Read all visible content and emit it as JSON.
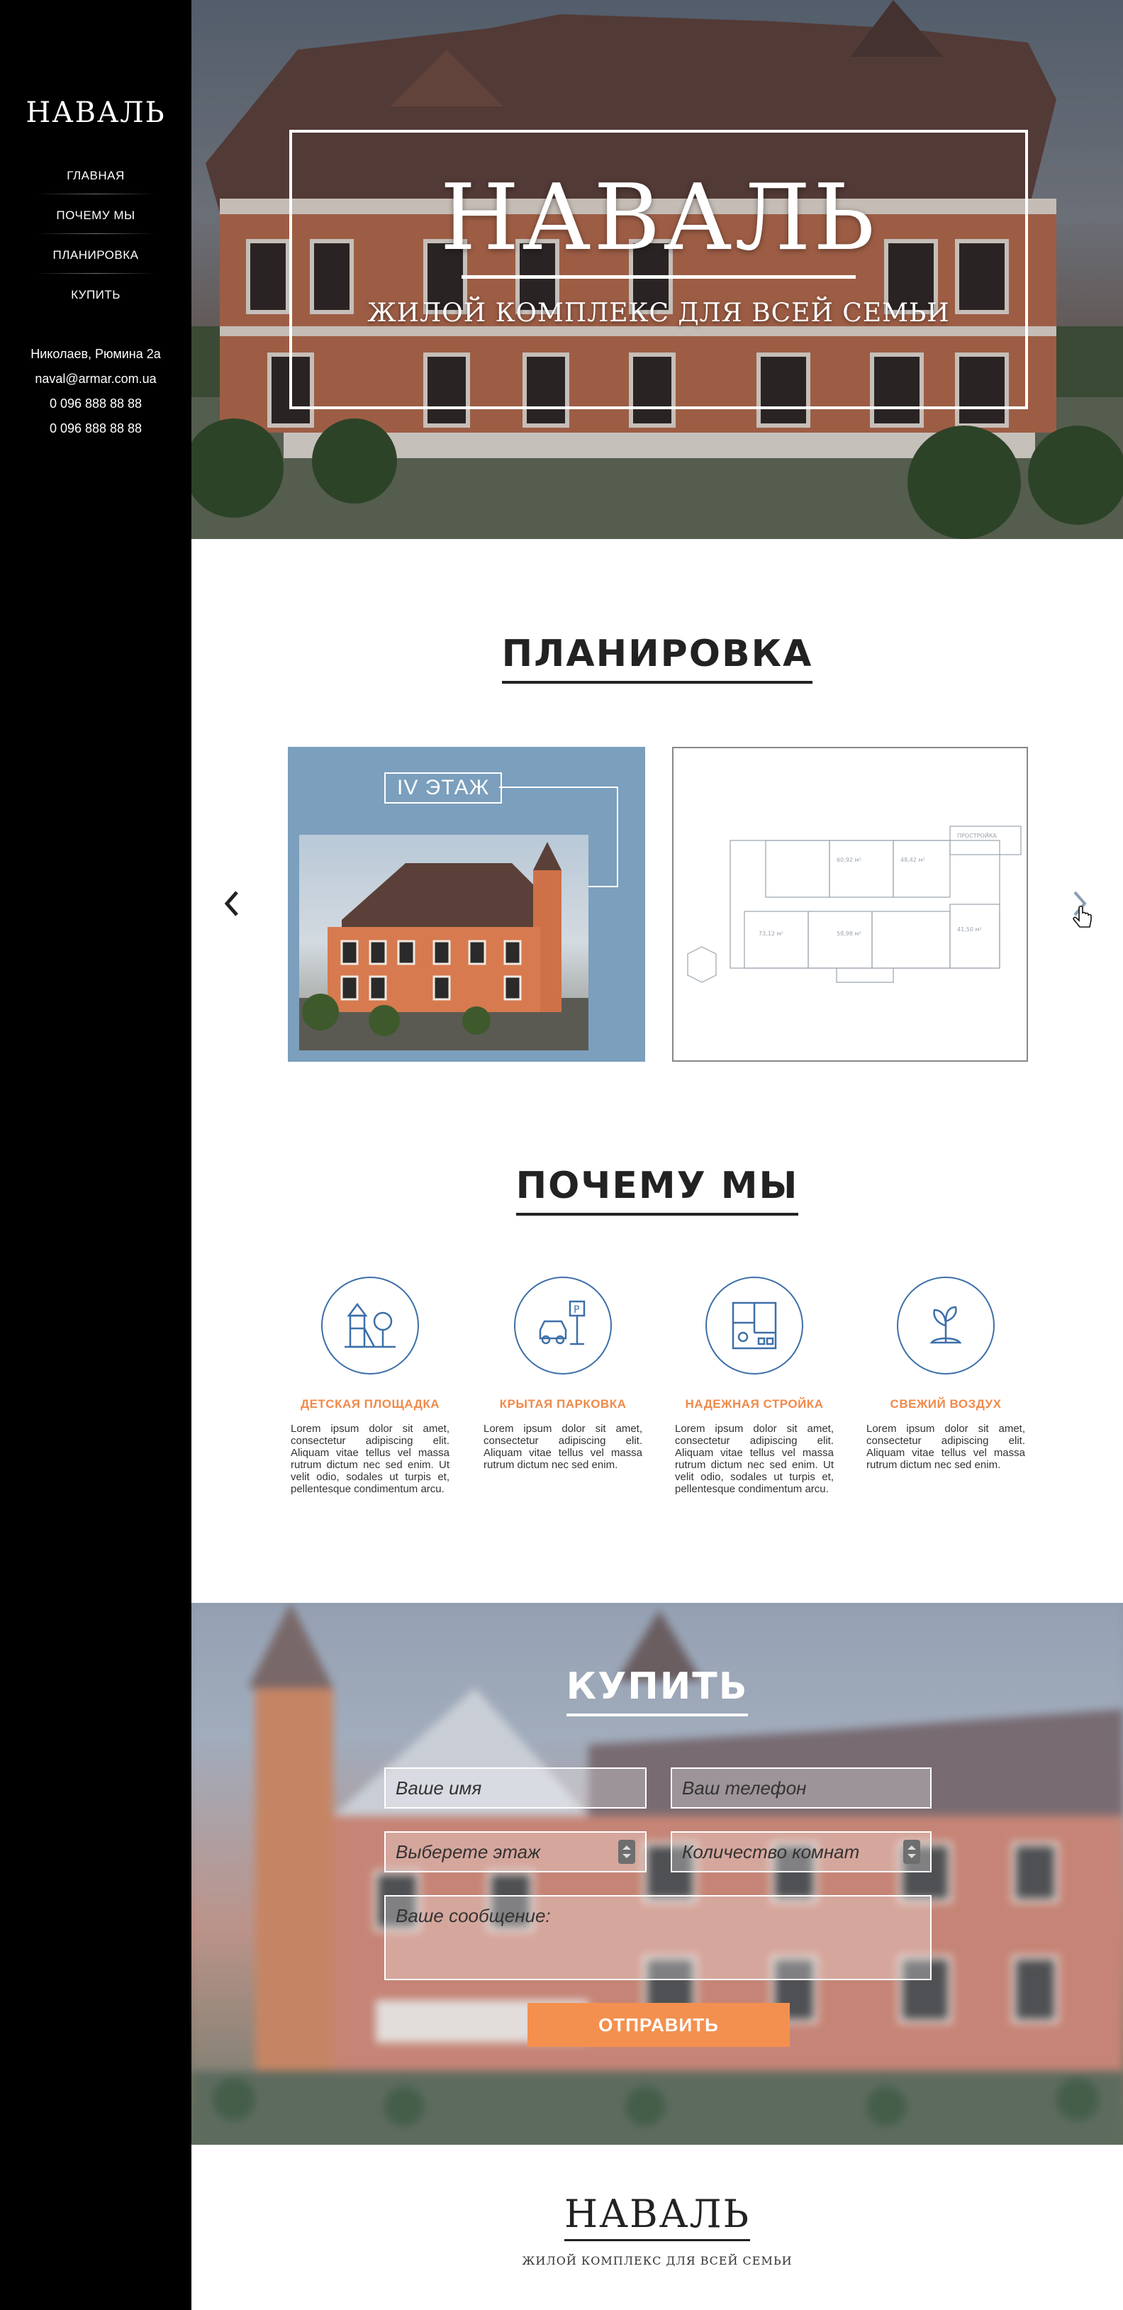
{
  "sidebar": {
    "logo": "НАВАЛЬ",
    "nav": [
      "ГЛАВНАЯ",
      "ПОЧЕМУ МЫ",
      "ПЛАНИРОВКА",
      "КУПИТЬ"
    ],
    "address": "Николаев, Рюмина 2а",
    "email": "naval@armar.com.ua",
    "phone1": "0 096 888 88 88",
    "phone2": "0 096 888 88 88"
  },
  "hero": {
    "title": "НАВАЛЬ",
    "subtitle": "ЖИЛОЙ КОМПЛЕКС ДЛЯ ВСЕЙ СЕМЬИ"
  },
  "plans": {
    "title": "ПЛАНИРОВКА",
    "floor_label": "IV ЭТАЖ",
    "prev_icon": "chevron-left-icon",
    "next_icon": "chevron-right-icon"
  },
  "why": {
    "title": "ПОЧЕМУ МЫ",
    "features": [
      {
        "icon": "playground-icon",
        "title": "ДЕТСКАЯ ПЛОЩАДКА",
        "text": "Lorem ipsum dolor sit amet, consectetur adipiscing elit. Aliquam vitae tellus vel massa rutrum dictum nec sed enim. Ut velit odio, sodales ut turpis et, pellentesque condimentum arcu."
      },
      {
        "icon": "parking-icon",
        "title": "КРЫТАЯ ПАРКОВКА",
        "text": "Lorem ipsum dolor sit amet, consectetur adipiscing elit. Aliquam vitae tellus vel massa rutrum dictum nec sed enim."
      },
      {
        "icon": "floorplan-icon",
        "title": "НАДЕЖНАЯ СТРОЙКА",
        "text": "Lorem ipsum dolor sit amet, consectetur adipiscing elit. Aliquam vitae tellus vel massa rutrum dictum nec sed enim. Ut velit odio, sodales ut turpis et, pellentesque condimentum arcu."
      },
      {
        "icon": "sprout-icon",
        "title": "СВЕЖИЙ ВОЗДУХ",
        "text": "Lorem ipsum dolor sit amet, consectetur adipiscing elit. Aliquam vitae tellus vel massa rutrum dictum nec sed enim."
      }
    ]
  },
  "buy": {
    "title": "КУПИТЬ",
    "name_placeholder": "Ваше имя",
    "phone_placeholder": "Ваш телефон",
    "floor_placeholder": "Выберете этаж",
    "rooms_placeholder": "Количество комнат",
    "message_placeholder": "Ваше сообщение:",
    "submit_label": "ОТПРАВИТЬ"
  },
  "footer": {
    "logo": "НАВАЛЬ",
    "subtitle": "ЖИЛОЙ КОМПЛЕКС ДЛЯ ВСЕЙ СЕМЬИ"
  },
  "colors": {
    "accent": "#f4904f",
    "icon_blue": "#3d6fa8",
    "sidebar": "#000000"
  }
}
